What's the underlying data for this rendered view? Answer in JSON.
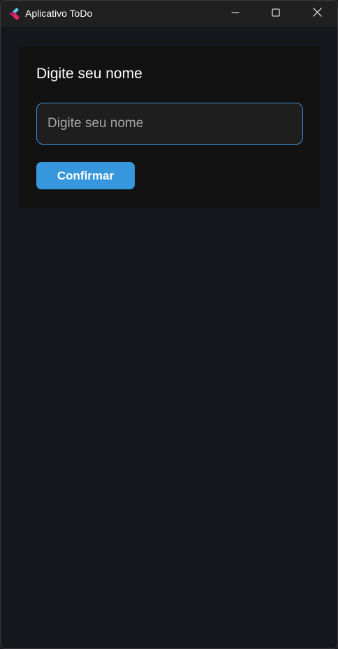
{
  "window": {
    "title": "Aplicativo ToDo",
    "icon": "flutter-app-icon",
    "controls": {
      "minimize": "minimize-icon",
      "maximize": "maximize-icon",
      "close": "close-icon"
    }
  },
  "form": {
    "heading": "Digite seu nome",
    "name_input": {
      "value": "",
      "placeholder": "Digite seu nome"
    },
    "confirm_label": "Confirmar"
  },
  "colors": {
    "accent": "#3697dd",
    "input_border": "#3d8fd6",
    "background": "#14171c",
    "card": "#121212",
    "titlebar": "#202020"
  }
}
